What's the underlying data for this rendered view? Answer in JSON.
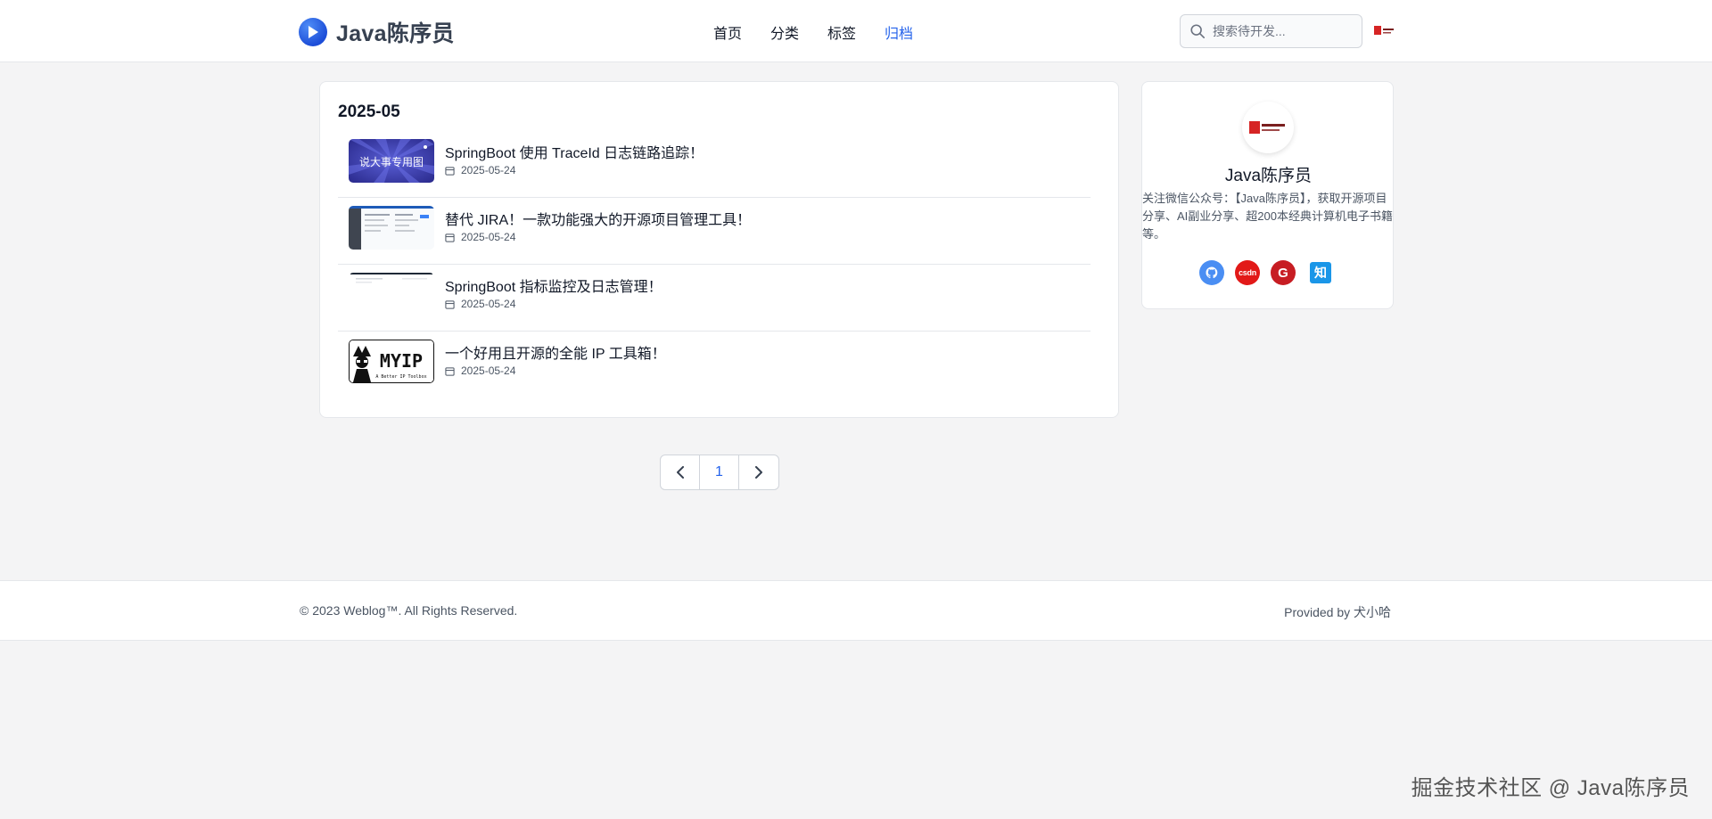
{
  "header": {
    "logo_text": "Java陈序员",
    "nav": [
      {
        "label": "首页",
        "active": false
      },
      {
        "label": "分类",
        "active": false
      },
      {
        "label": "标签",
        "active": false
      },
      {
        "label": "归档",
        "active": true
      }
    ],
    "search_placeholder": "搜索待开发..."
  },
  "archive": {
    "month": "2025-05",
    "posts": [
      {
        "title": "SpringBoot 使用 TraceId 日志链路追踪！",
        "date": "2025-05-24",
        "thumb_text": "说大事专用图"
      },
      {
        "title": "替代 JIRA！一款功能强大的开源项目管理工具！",
        "date": "2025-05-24"
      },
      {
        "title": "SpringBoot 指标监控及日志管理！",
        "date": "2025-05-24"
      },
      {
        "title": "一个好用且开源的全能 IP 工具箱！",
        "date": "2025-05-24",
        "thumb_text": "MYIP",
        "thumb_subtext": "A Better IP Toolbox"
      }
    ]
  },
  "pagination": {
    "current": "1"
  },
  "sidebar": {
    "name": "Java陈序员",
    "description": "关注微信公众号：【Java陈序员】，获取开源项目分享、AI副业分享、超200本经典计算机电子书籍等。",
    "social": [
      {
        "icon": "github-icon"
      },
      {
        "icon": "csdn-icon",
        "text": "csdn"
      },
      {
        "icon": "gitee-icon",
        "text": "G"
      },
      {
        "icon": "zhihu-icon",
        "text": "知"
      }
    ]
  },
  "footer": {
    "copyright": "© 2023 Weblog™. All Rights Reserved.",
    "provided": "Provided by 犬小哈"
  },
  "watermark": "掘金技术社区 @ Java陈序员",
  "colors": {
    "accent": "#2563eb",
    "background": "#f4f4f5",
    "card": "#ffffff"
  }
}
